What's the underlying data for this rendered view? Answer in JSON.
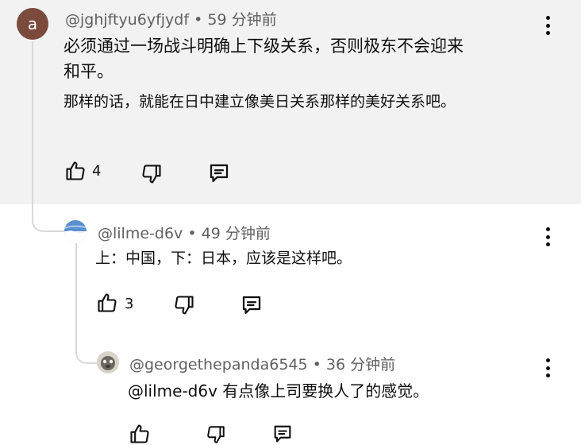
{
  "comments": [
    {
      "avatar_letter": "a",
      "avatar_color": "#7a4a3c",
      "handle": "@jghjftyu6yfjydf",
      "time": "59 分钟前",
      "text_line1": "必须通过一场战斗明确上下级关系，否则极东不会迎来",
      "text_line2": "和平。",
      "translation": "那样的话，就能在日中建立像美日关系那样的美好关系吧。",
      "likes": "4"
    },
    {
      "handle": "@lilme-d6v",
      "time": "49 分钟前",
      "text": "上：中国，下：日本，应该是这样吧。",
      "likes": "3"
    },
    {
      "handle": "@georgethepanda6545",
      "time": "36 分钟前",
      "text": "@lilme-d6v 有点像上司要换人了的感觉。"
    }
  ],
  "separator": "•",
  "icons": {
    "like": "thumb-up-icon",
    "dislike": "thumb-down-icon",
    "reply": "reply-comment-icon",
    "more": "more-vertical-icon"
  }
}
